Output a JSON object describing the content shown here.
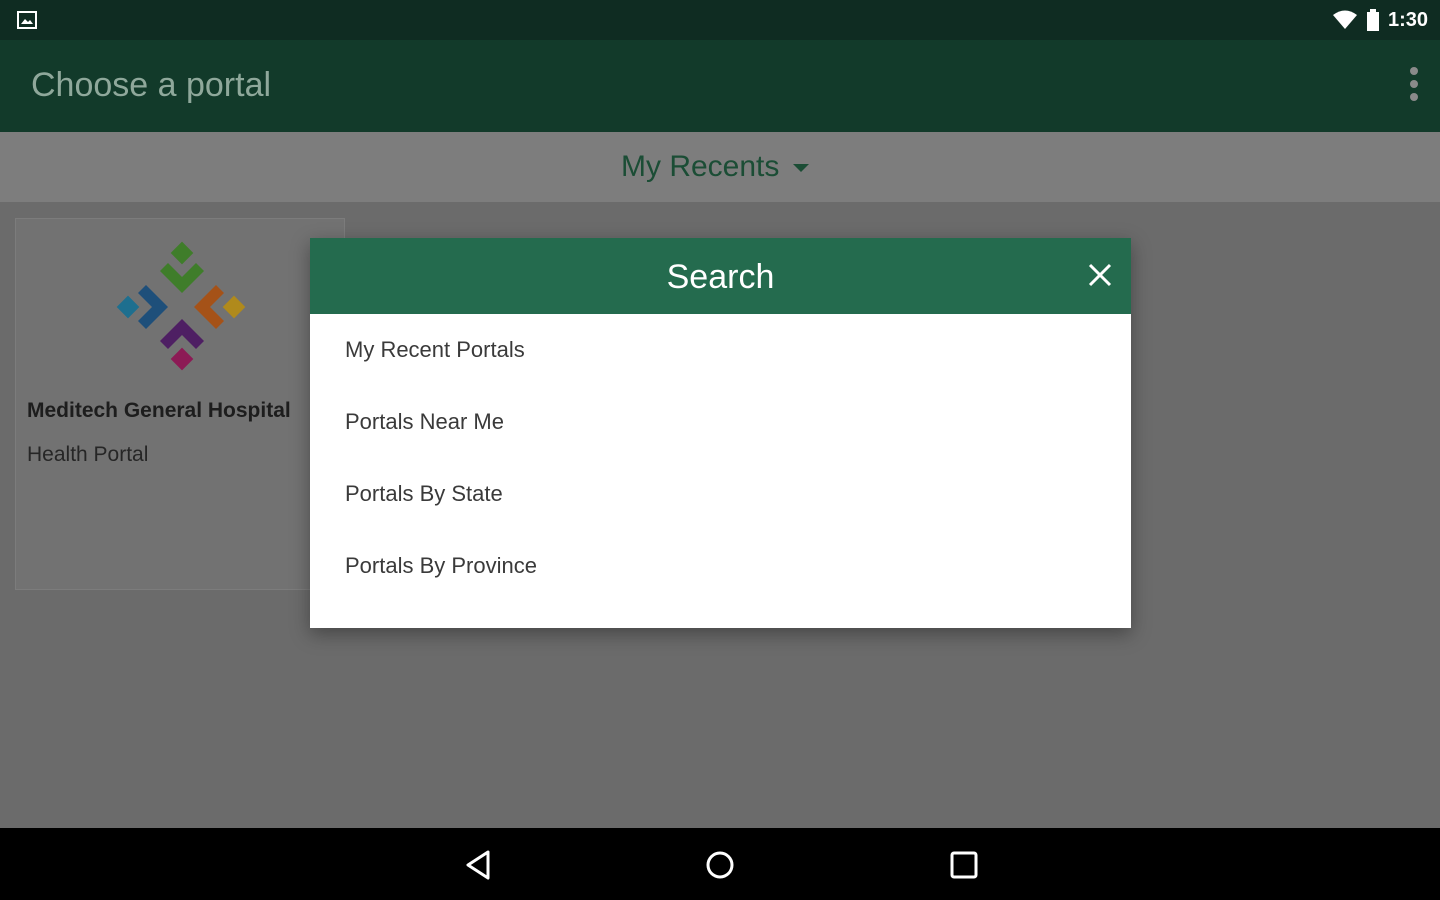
{
  "status_bar": {
    "time": "1:30",
    "left_icon": "image-icon",
    "right_icons": [
      "wifi-icon",
      "battery-icon"
    ]
  },
  "app_bar": {
    "title": "Choose a portal",
    "overflow_icon": "more-vert-icon"
  },
  "filter": {
    "selected": "My Recents",
    "icon": "caret-down-icon"
  },
  "portal_card": {
    "name": "Meditech General Hospital",
    "type": "Health Portal"
  },
  "dialog": {
    "title": "Search",
    "close_icon": "close-icon",
    "options": [
      "My Recent Portals",
      "Portals Near Me",
      "Portals By State",
      "Portals By Province"
    ]
  },
  "nav_bar": {
    "icons": [
      "back-icon",
      "home-icon",
      "recents-icon"
    ]
  },
  "colors": {
    "status_bar_bg": "#0f2c22",
    "app_bar_bg": "#123a2a",
    "dialog_header_bg": "#246b4e",
    "accent_green": "#1b4d35",
    "scrim": "#6b6b6b"
  }
}
